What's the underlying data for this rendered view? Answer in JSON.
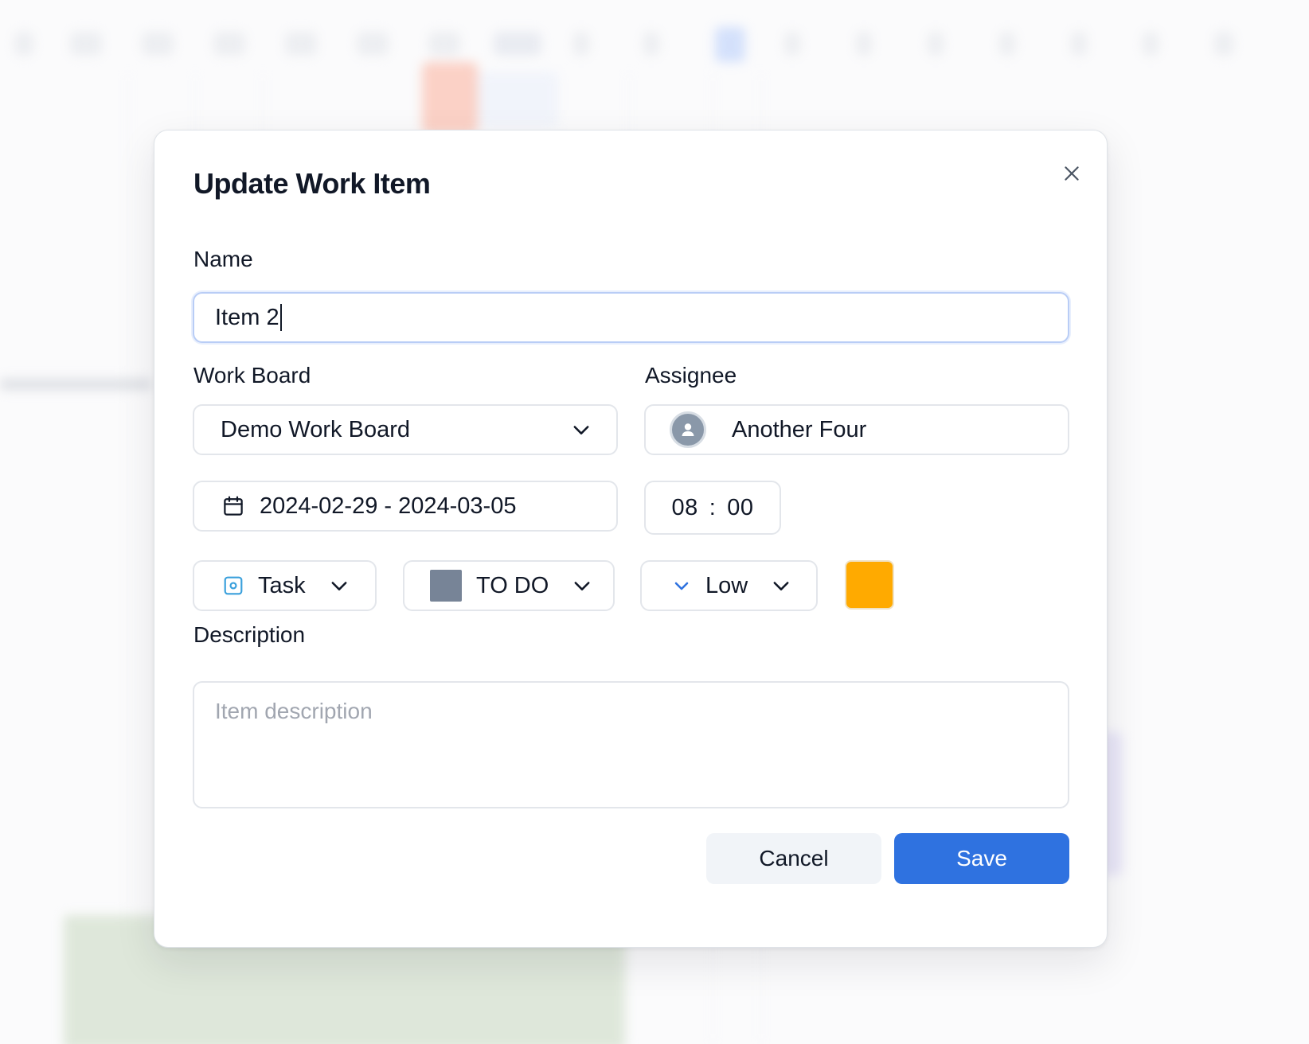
{
  "modal": {
    "title": "Update Work Item",
    "close_icon": "close-icon"
  },
  "form": {
    "name_label": "Name",
    "name_value": "Item 2",
    "work_board_label": "Work Board",
    "work_board_value": "Demo Work Board",
    "assignee_label": "Assignee",
    "assignee_value": "Another Four",
    "date_range": "2024-02-29 - 2024-03-05",
    "time_hours": "08",
    "time_separator": ":",
    "time_minutes": "00",
    "type_value": "Task",
    "status_value": "TO DO",
    "status_color": "#778497",
    "priority_value": "Low",
    "priority_color": "#2f72e0",
    "item_color": "#ffaa00",
    "description_label": "Description",
    "description_placeholder": "Item description",
    "description_value": ""
  },
  "actions": {
    "cancel_label": "Cancel",
    "save_label": "Save"
  },
  "colors": {
    "primary": "#2f72e0",
    "border": "#e3e6eb",
    "focus_border": "#b9cdf6"
  }
}
